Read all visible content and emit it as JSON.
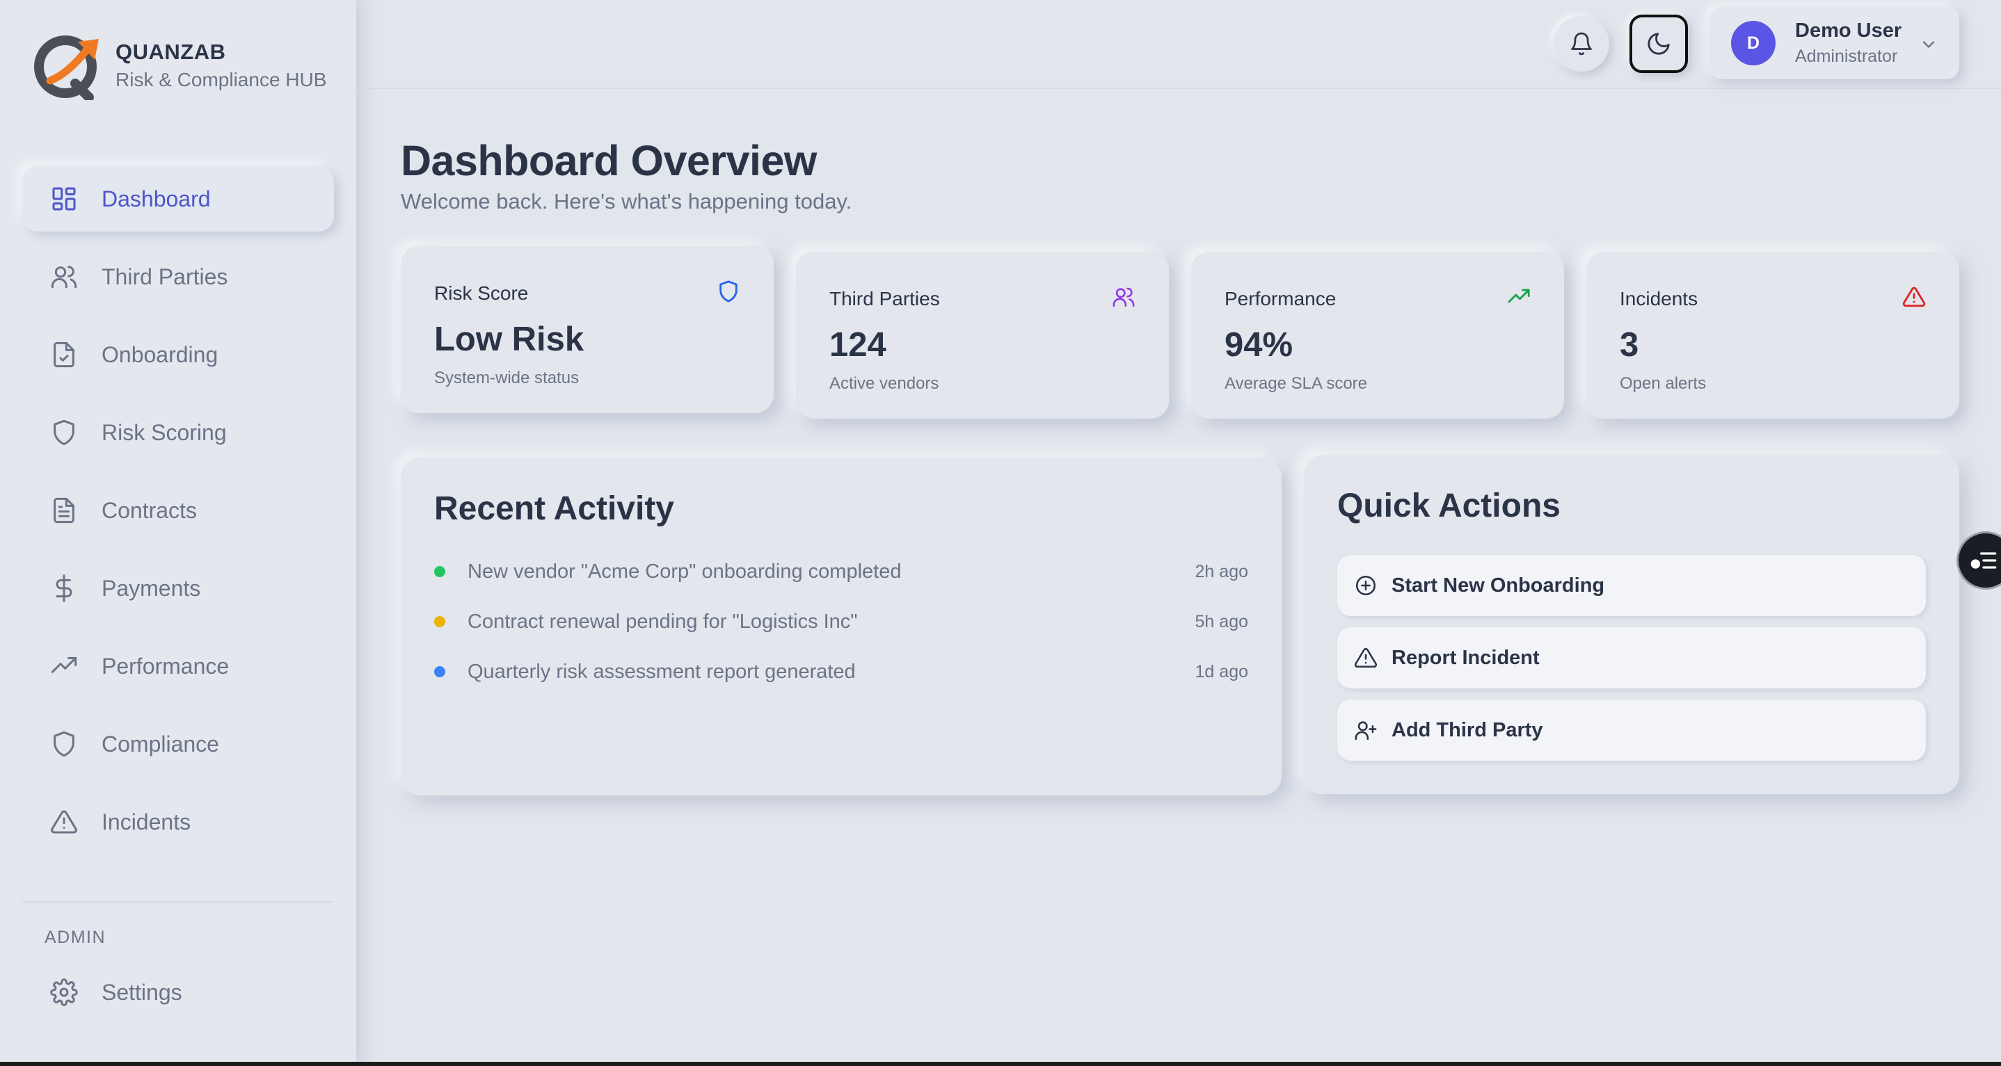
{
  "brand": {
    "name": "QUANZAB",
    "subtitle": "Risk & Compliance HUB",
    "colors": {
      "ring": "#4a4f57",
      "arrow": "#f07a24"
    }
  },
  "sidebar": {
    "items": [
      {
        "label": "Dashboard",
        "icon": "dashboard-grid-icon",
        "active": true
      },
      {
        "label": "Third Parties",
        "icon": "users-icon"
      },
      {
        "label": "Onboarding",
        "icon": "file-check-icon"
      },
      {
        "label": "Risk Scoring",
        "icon": "shield-icon"
      },
      {
        "label": "Contracts",
        "icon": "file-text-icon"
      },
      {
        "label": "Payments",
        "icon": "dollar-icon"
      },
      {
        "label": "Performance",
        "icon": "trending-up-icon"
      },
      {
        "label": "Compliance",
        "icon": "shield-icon"
      },
      {
        "label": "Incidents",
        "icon": "alert-triangle-icon"
      }
    ],
    "admin_label": "ADMIN",
    "settings_label": "Settings",
    "active_color": "#4e55c9"
  },
  "topbar": {
    "notification_icon": "bell-icon",
    "theme_icon": "moon-icon",
    "user": {
      "initial": "D",
      "name": "Demo User",
      "role": "Administrator",
      "avatar_color": "#5b55e6"
    }
  },
  "header": {
    "title": "Dashboard Overview",
    "subtitle": "Welcome back. Here's what's happening today."
  },
  "stats": [
    {
      "label": "Risk Score",
      "value": "Low Risk",
      "desc": "System-wide status",
      "icon": "shield-icon",
      "color": "#2563eb"
    },
    {
      "label": "Third Parties",
      "value": "124",
      "desc": "Active vendors",
      "icon": "users-icon",
      "color": "#9333ea"
    },
    {
      "label": "Performance",
      "value": "94%",
      "desc": "Average SLA score",
      "icon": "trending-up-icon",
      "color": "#16a34a"
    },
    {
      "label": "Incidents",
      "value": "3",
      "desc": "Open alerts",
      "icon": "alert-triangle-icon",
      "color": "#dc2626"
    }
  ],
  "activity": {
    "title": "Recent Activity",
    "items": [
      {
        "text": "New vendor \"Acme Corp\" onboarding completed",
        "time": "2h ago",
        "color": "#22c55e"
      },
      {
        "text": "Contract renewal pending for \"Logistics Inc\"",
        "time": "5h ago",
        "color": "#eab308"
      },
      {
        "text": "Quarterly risk assessment report generated",
        "time": "1d ago",
        "color": "#3b82f6"
      }
    ]
  },
  "quick_actions": {
    "title": "Quick Actions",
    "items": [
      {
        "label": "Start New Onboarding",
        "icon": "plus-circle-icon"
      },
      {
        "label": "Report Incident",
        "icon": "alert-triangle-icon"
      },
      {
        "label": "Add Third Party",
        "icon": "user-plus-icon"
      }
    ]
  },
  "float_button_icon": "list-toggle-icon"
}
